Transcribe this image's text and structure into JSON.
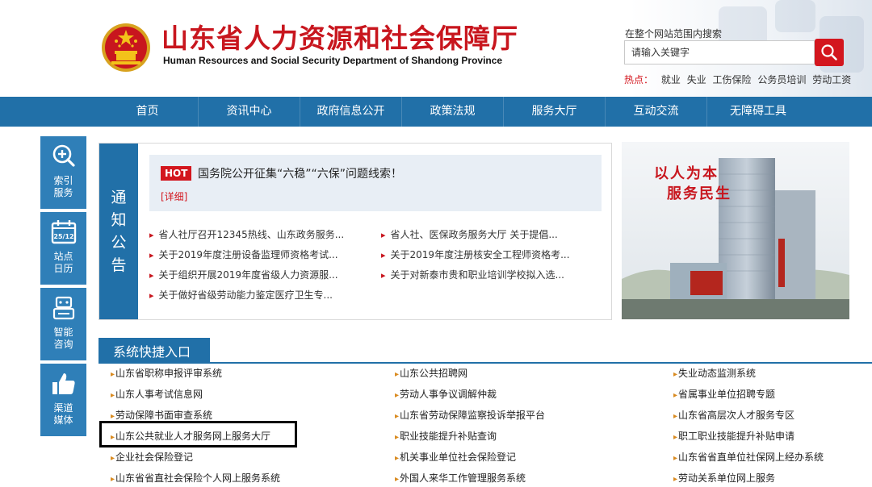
{
  "header": {
    "title": "山东省人力资源和社会保障厅",
    "subtitle": "Human Resources and Social Security Department of Shandong Province"
  },
  "search": {
    "hint": "在整个网站范围内搜索",
    "placeholder": "请输入关键字",
    "hot_label": "热点：",
    "hot_keywords": [
      "就业",
      "失业",
      "工伤保险",
      "公务员培训",
      "劳动工资"
    ]
  },
  "nav": {
    "items": [
      "首页",
      "资讯中心",
      "政府信息公开",
      "政策法规",
      "服务大厅",
      "互动交流",
      "无障碍工具"
    ]
  },
  "side": {
    "items": [
      {
        "label": "索引服务",
        "icon": "search-plus-icon"
      },
      {
        "label": "站点日历",
        "icon": "calendar-icon",
        "date": "25/12"
      },
      {
        "label": "智能咨询",
        "icon": "robot-icon"
      },
      {
        "label": "渠道媒体",
        "icon": "thumbs-up-icon"
      }
    ]
  },
  "notice": {
    "tab_chars": [
      "通",
      "知",
      "公",
      "告"
    ],
    "hot_tag": "HOT",
    "hot_title": "国务院公开征集“六稳”“六保”问题线索！",
    "hot_more": "[详细]",
    "items": [
      "省人社厅召开12345热线、山东政务服务...",
      "省人社、医保政务服务大厅 关于提倡...",
      "关于2019年度注册设备监理师资格考试...",
      "关于2019年度注册核安全工程师资格考...",
      "关于组织开展2019年度省级人力资源服...",
      "关于对新泰市贵和职业培训学校拟入选...",
      "关于做好省级劳动能力鉴定医疗卫生专..."
    ]
  },
  "promo": {
    "slogan_line1": "以人为本",
    "slogan_line2": "服务民生"
  },
  "quicklinks": {
    "title": "系统快捷入口",
    "items": [
      "山东省职称申报评审系统",
      "山东公共招聘网",
      "失业动态监测系统",
      "山东人事考试信息网",
      "劳动人事争议调解仲裁",
      "省属事业单位招聘专题",
      "劳动保障书面审查系统",
      "山东省劳动保障监察投诉举报平台",
      "山东省高层次人才服务专区",
      "山东公共就业人才服务网上服务大厅",
      "职业技能提升补贴查询",
      "职工职业技能提升补贴申请",
      "企业社会保险登记",
      "机关事业单位社会保险登记",
      "山东省省直单位社保网上经办系统",
      "山东省省直社会保险个人网上服务系统",
      "外国人来华工作管理服务系统",
      "劳动关系单位网上服务"
    ]
  },
  "colors": {
    "brand_red": "#c8161e",
    "nav_blue": "#2170a8",
    "side_blue": "#2f7fb8"
  }
}
